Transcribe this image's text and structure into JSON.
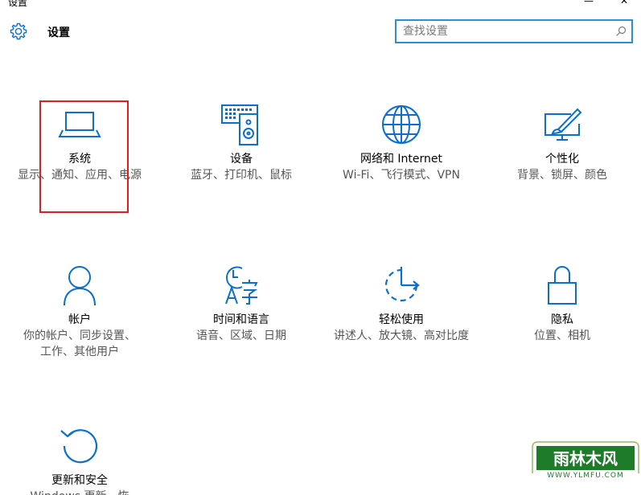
{
  "window": {
    "title": "设置",
    "minimize_glyph": "—",
    "close_glyph": "✕"
  },
  "header": {
    "title": "设置",
    "icon": "gear-icon"
  },
  "search": {
    "placeholder": "查找设置",
    "value": "",
    "icon": "search-icon"
  },
  "accent_color": "#0a6fce",
  "selection_color": "#e11e1e",
  "tiles": [
    {
      "id": "system",
      "name": "系统",
      "desc": "显示、通知、应用、电源",
      "icon": "laptop-icon",
      "selected": true
    },
    {
      "id": "devices",
      "name": "设备",
      "desc": "蓝牙、打印机、鼠标",
      "icon": "devices-icon"
    },
    {
      "id": "network",
      "name": "网络和 Internet",
      "desc": "Wi-Fi、飞行模式、VPN",
      "icon": "globe-icon"
    },
    {
      "id": "personalization",
      "name": "个性化",
      "desc": "背景、锁屏、颜色",
      "icon": "personalization-icon"
    },
    {
      "id": "accounts",
      "name": "帐户",
      "desc": "你的帐户、同步设置、工作、其他用户",
      "icon": "person-icon"
    },
    {
      "id": "time-language",
      "name": "时间和语言",
      "desc": "语音、区域、日期",
      "icon": "time-language-icon"
    },
    {
      "id": "ease-of-access",
      "name": "轻松使用",
      "desc": "讲述人、放大镜、高对比度",
      "icon": "ease-of-access-icon"
    },
    {
      "id": "privacy",
      "name": "隐私",
      "desc": "位置、相机",
      "icon": "lock-icon"
    },
    {
      "id": "update-security",
      "name": "更新和安全",
      "desc": "Windows 更新、恢",
      "icon": "update-icon"
    }
  ],
  "watermark": {
    "logo_text": "雨林木风",
    "url_text": "WWW.YLMFU.COM"
  }
}
